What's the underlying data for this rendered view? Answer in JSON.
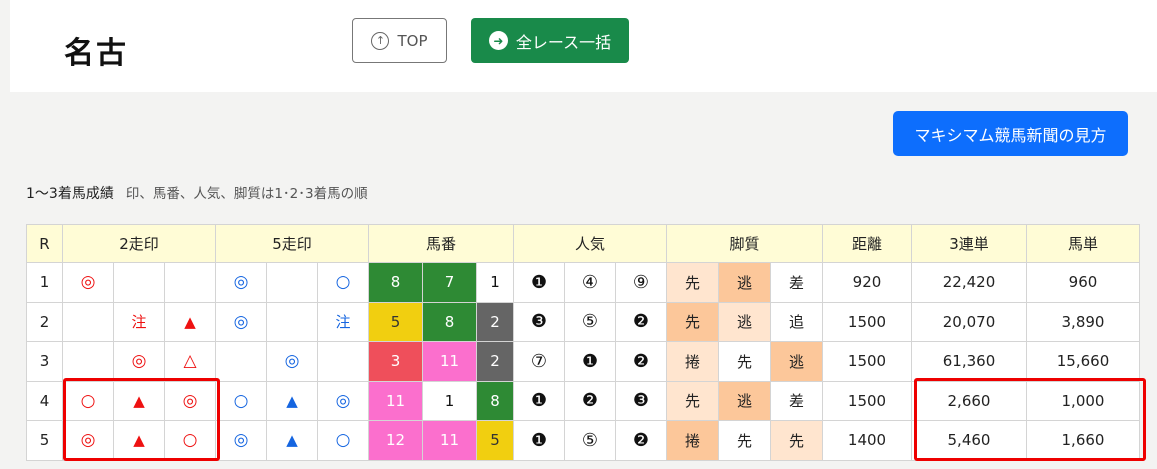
{
  "header": {
    "venue": "名古",
    "top_button": "TOP",
    "top_icon": "arrow-up-circle",
    "all_races_button": "全レース一括",
    "all_races_icon": "arrow-right-circle"
  },
  "guide_button": "マキシマム競馬新聞の見方",
  "note": {
    "title": "1〜3着馬成績",
    "subtitle": "印、馬番、人気、脚質は1･2･3着馬の順"
  },
  "table": {
    "headers": {
      "r": "R",
      "mark2": "2走印",
      "mark5": "5走印",
      "umaban": "馬番",
      "ninki": "人気",
      "kyakushitsu": "脚質",
      "kyori": "距離",
      "sanrentan": "3連単",
      "umatan": "馬単"
    },
    "rows": [
      {
        "r": "1",
        "mark2": [
          "◎",
          "",
          ""
        ],
        "mark5": [
          "◎",
          "",
          "○"
        ],
        "umaban": [
          "8",
          "7",
          "1"
        ],
        "ninki": [
          "❶",
          "④",
          "⑨"
        ],
        "style": [
          "先",
          "逃",
          "差"
        ],
        "kyori": "920",
        "sanrentan": "22,420",
        "umatan": "960"
      },
      {
        "r": "2",
        "mark2": [
          "",
          "注",
          "▲"
        ],
        "mark5": [
          "◎",
          "",
          "注"
        ],
        "umaban": [
          "5",
          "8",
          "2"
        ],
        "ninki": [
          "❸",
          "⑤",
          "❷"
        ],
        "style": [
          "先",
          "逃",
          "追"
        ],
        "kyori": "1500",
        "sanrentan": "20,070",
        "umatan": "3,890"
      },
      {
        "r": "3",
        "mark2": [
          "",
          "◎",
          "△"
        ],
        "mark5": [
          "",
          "◎",
          ""
        ],
        "umaban": [
          "3",
          "11",
          "2"
        ],
        "ninki": [
          "⑦",
          "❶",
          "❷"
        ],
        "style": [
          "捲",
          "先",
          "逃"
        ],
        "kyori": "1500",
        "sanrentan": "61,360",
        "umatan": "15,660"
      },
      {
        "r": "4",
        "mark2": [
          "○",
          "▲",
          "◎"
        ],
        "mark5": [
          "○",
          "▲",
          "◎"
        ],
        "umaban": [
          "11",
          "1",
          "8"
        ],
        "ninki": [
          "❶",
          "❷",
          "❸"
        ],
        "style": [
          "先",
          "逃",
          "差"
        ],
        "kyori": "1500",
        "sanrentan": "2,660",
        "umatan": "1,000"
      },
      {
        "r": "5",
        "mark2": [
          "◎",
          "▲",
          "○"
        ],
        "mark5": [
          "◎",
          "▲",
          "○"
        ],
        "umaban": [
          "12",
          "11",
          "5"
        ],
        "ninki": [
          "❶",
          "⑤",
          "❷"
        ],
        "style": [
          "捲",
          "先",
          "先"
        ],
        "kyori": "1400",
        "sanrentan": "5,460",
        "umatan": "1,660"
      }
    ]
  },
  "colors": {
    "all_races_button": "#198a4a",
    "guide_button": "#0d6efd",
    "header_row": "#fffcd6",
    "highlight": "#e00000",
    "mark2": "#e11111",
    "mark5": "#1565e0"
  }
}
